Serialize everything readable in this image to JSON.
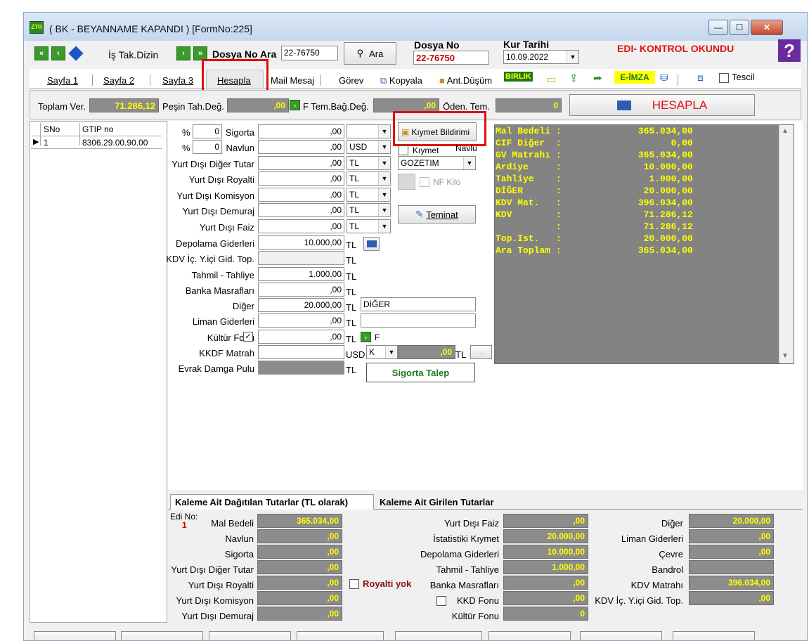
{
  "window": {
    "title": "( BK  - BEYANNAME KAPANDI ) [FormNo:225]",
    "minimize": "—",
    "maximize": "☐",
    "close": "✕"
  },
  "toolbar": {
    "is_takip_label": "İş Tak.Dizin",
    "dosya_ara_label": "Dosya No Ara",
    "dosya_ara_value": "22-76750",
    "ara_button": "Ara",
    "dosya_no_label": "Dosya No",
    "dosya_no_value": "22-76750",
    "kur_tarihi_label": "Kur Tarihi",
    "kur_tarihi_value": "10.09.2022",
    "status": "EDI- KONTROL OKUNDU",
    "help": "?"
  },
  "tabs": [
    "Sayfa 1",
    "Sayfa 2",
    "Sayfa 3",
    "Hesapla",
    "Mail Mesaj",
    "Görev",
    "Kopyala",
    "Ant.Düşüm",
    "BIRLIK",
    "E-İMZA",
    "Tescil"
  ],
  "summary": {
    "toplam_ver_label": "Toplam Ver.",
    "toplam_ver_value": "71.286,12",
    "pesin_label": "Peşin Tah.Değ.",
    "pesin_value": ",00",
    "teminat_label": "F Tem.Bağ.Değ.",
    "teminat_value": ",00",
    "odenen_label": "Öden. Tem.",
    "odenen_value": "0",
    "hesapla_button": "HESAPLA"
  },
  "items_table": {
    "headers": [
      "SNo",
      "GTIP no"
    ],
    "rows": [
      [
        "1",
        "8306.29.00.90.00"
      ]
    ]
  },
  "form": {
    "sigorta_pct": "0",
    "navlun_pct": "0",
    "pct_symbol": "%",
    "rows": [
      {
        "label": "Sigorta",
        "value": ",00",
        "unit": ""
      },
      {
        "label": "Navlun",
        "value": ",00",
        "unit": "USD"
      },
      {
        "label": "Yurt Dışı Diğer Tutar",
        "value": ",00",
        "unit": "TL"
      },
      {
        "label": "Yurt Dışı Royalti",
        "value": ",00",
        "unit": "TL"
      },
      {
        "label": "Yurt Dışı Komisyon",
        "value": ",00",
        "unit": "TL"
      },
      {
        "label": "Yurt Dışı Demuraj",
        "value": ",00",
        "unit": "TL"
      },
      {
        "label": "Yurt Dışı Faiz",
        "value": ",00",
        "unit": "TL"
      },
      {
        "label": "Depolama Giderleri",
        "value": "10.000,00",
        "unit": "TL"
      },
      {
        "label": "KDV İç. Y.içi Gid. Top.",
        "value": "",
        "unit": "TL"
      },
      {
        "label": "Tahmil - Tahliye",
        "value": "1.000,00",
        "unit": "TL"
      },
      {
        "label": "Banka Masrafları",
        "value": ",00",
        "unit": "TL"
      },
      {
        "label": "Diğer",
        "value": "20.000,00",
        "unit": "TL"
      },
      {
        "label": "Liman Giderleri",
        "value": ",00",
        "unit": "TL"
      },
      {
        "label": "Kültür Fonu",
        "value": ",00",
        "unit": "TL"
      },
      {
        "label": "KKDF Matrah",
        "value": "",
        "unit": "USD"
      },
      {
        "label": "Evrak Damga Pulu",
        "value": "",
        "unit": "TL"
      }
    ],
    "diger_desc": "DİĞER",
    "kkdf_combo": "K",
    "kkdf_value": ",00",
    "kkdf_unit": "TL",
    "f_label": "F",
    "kiymet_button": "Kıymet Bildirimi",
    "kiymet_check": "Kıymet",
    "navlun_check": "Navlu",
    "gozetim": "GOZETIM",
    "nf_kilo": "NF Kilo",
    "teminat_button": "Teminat",
    "sigorta_talep": "Sigorta Talep"
  },
  "calc_panel": [
    "Mal Bedeli :              365.034,00",
    "CIF Diğer  :                    0,00",
    "GV Matrahı :              365.034,00",
    "Ardiye     :               10.000,00",
    "Tahliye    :                1.000,00",
    "DİĞER      :               20.000,00",
    "KDV Mat.   :              396.034,00",
    "KDV        :               71.286,12",
    "           :               71.286,12",
    "Top.Ist.   :               20.000,00",
    "Ara Toplam :              365.034,00"
  ],
  "bottom": {
    "tab1": "Kaleme Ait Dağıtılan Tutarlar (TL olarak)",
    "tab2": "Kaleme Ait Girilen Tutarlar",
    "edi_no_label": "Edi No:",
    "edi_no_value": "1",
    "col1": [
      [
        "Mal Bedeli",
        "365.034,00"
      ],
      [
        "Navlun",
        ",00"
      ],
      [
        "Sigorta",
        ",00"
      ],
      [
        "Yurt Dışı Diğer Tutar",
        ",00"
      ],
      [
        "Yurt Dışı Royalti",
        ",00"
      ],
      [
        "Yurt Dışı Komisyon",
        ",00"
      ],
      [
        "Yurt Dışı Demuraj",
        ",00"
      ]
    ],
    "col2": [
      [
        "Yurt Dışı Faiz",
        ",00"
      ],
      [
        "İstatistiki Kıymet",
        "20.000,00"
      ],
      [
        "Depolama Giderleri",
        "10.000,00"
      ],
      [
        "Tahmil - Tahliye",
        "1.000,00"
      ],
      [
        "Banka Masrafları",
        ",00"
      ],
      [
        "KKD Fonu",
        ",00"
      ],
      [
        "Kültür Fonu",
        "0"
      ]
    ],
    "col3": [
      [
        "Diğer",
        "20.000,00"
      ],
      [
        "Liman Giderleri",
        ",00"
      ],
      [
        "Çevre",
        ",00"
      ],
      [
        "Bandrol",
        ""
      ],
      [
        "KDV Matrahı",
        "396.034,00"
      ],
      [
        "KDV İç. Y.içi Gid. Top.",
        ",00"
      ]
    ],
    "royalti_yok": "Royalti yok"
  },
  "colors": {
    "panel": "#838383",
    "value_text": "#ffff00",
    "accent_red": "#e01010",
    "title_bar": "#c4d7ee"
  }
}
